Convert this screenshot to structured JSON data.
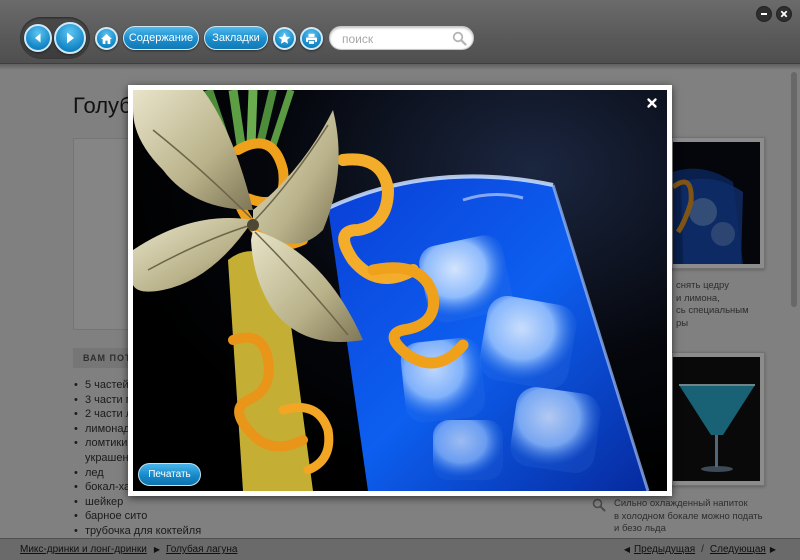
{
  "toolbar": {
    "back_icon": "arrow-left-icon",
    "forward_icon": "arrow-right-icon",
    "home_icon": "home-icon",
    "contents_label": "Содержание",
    "bookmarks_label": "Закладки",
    "favorite_icon": "star-icon",
    "print_icon": "printer-icon",
    "search_placeholder": "поиск",
    "accent_color": "#1a8ccc"
  },
  "window": {
    "minimize_icon": "minimize-icon",
    "close_icon": "close-icon"
  },
  "page": {
    "title": "Голуб",
    "section_header": "ВАМ ПОТ",
    "ingredients": [
      "5 частей",
      "3 части п",
      "2 части л",
      "лимонад",
      "ломтики",
      "украшен",
      "лед",
      "бокал-ха",
      "шейкер",
      "барное сито",
      "трубочка для коктейля"
    ],
    "side_caption_1": [
      "снять цедру",
      "и лимона,",
      "сь специальным",
      "ры"
    ],
    "side_caption_2": [
      "Сильно охлажденный напиток",
      "в холодном бокале можно подать",
      "и безо льда"
    ]
  },
  "lightbox": {
    "close_icon": "close-icon",
    "print_label": "Печатать"
  },
  "bottombar": {
    "breadcrumb_1": "Микс-дринки и лонг-дринки",
    "breadcrumb_2": "Голубая лагуна",
    "prev_label": "Предыдущая",
    "next_label": "Следующая"
  }
}
